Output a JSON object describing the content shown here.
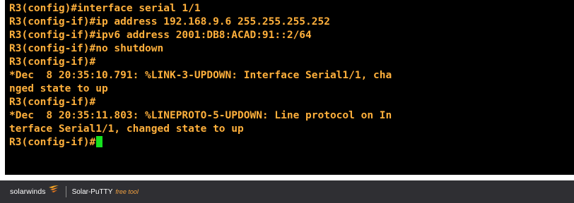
{
  "terminal": {
    "lines": [
      "R3(config)#interface serial 1/1",
      "R3(config-if)#ip address 192.168.9.6 255.255.255.252",
      "R3(config-if)#ipv6 address 2001:DB8:ACAD:91::2/64",
      "R3(config-if)#no shutdown",
      "R3(config-if)#",
      "*Dec  8 20:35:10.791: %LINK-3-UPDOWN: Interface Serial1/1, cha",
      "nged state to up",
      "R3(config-if)#",
      "*Dec  8 20:35:11.803: %LINEPROTO-5-UPDOWN: Line protocol on In",
      "terface Serial1/1, changed state to up",
      "R3(config-if)#"
    ],
    "text_color": "#ffb03c",
    "background": "#000000",
    "cursor_color": "#16e21f"
  },
  "footer": {
    "brand_name": "solarwinds",
    "brand_icon": "flame-icon",
    "product_name": "Solar-PuTTY",
    "product_tag": "free tool",
    "background": "#2f2f33",
    "tag_color": "#f0a040"
  }
}
